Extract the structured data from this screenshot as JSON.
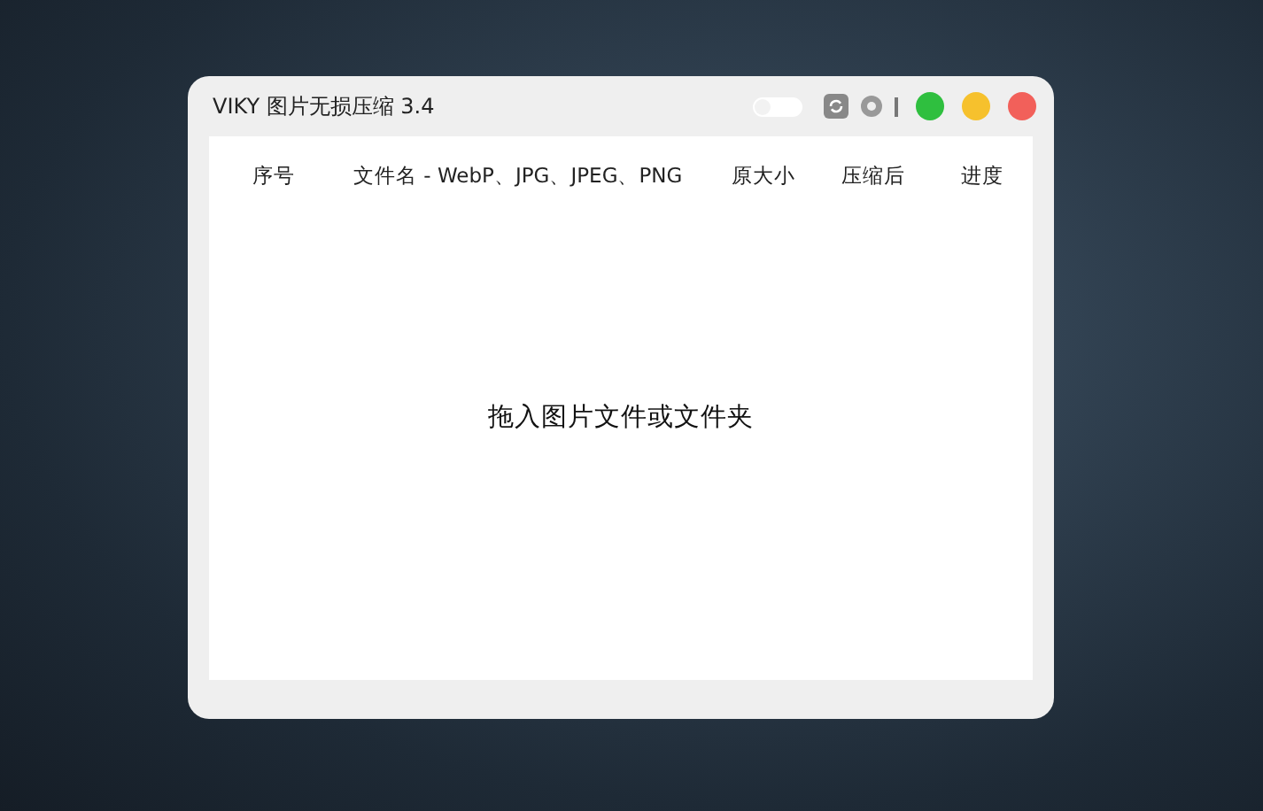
{
  "window": {
    "title": "VIKY 图片无损压缩 3.4"
  },
  "toggle": {
    "on": false
  },
  "table": {
    "columns": [
      "序号",
      "文件名 - WebP、JPG、JPEG、PNG",
      "原大小",
      "压缩后",
      "进度"
    ]
  },
  "empty_hint": "拖入图片文件或文件夹"
}
